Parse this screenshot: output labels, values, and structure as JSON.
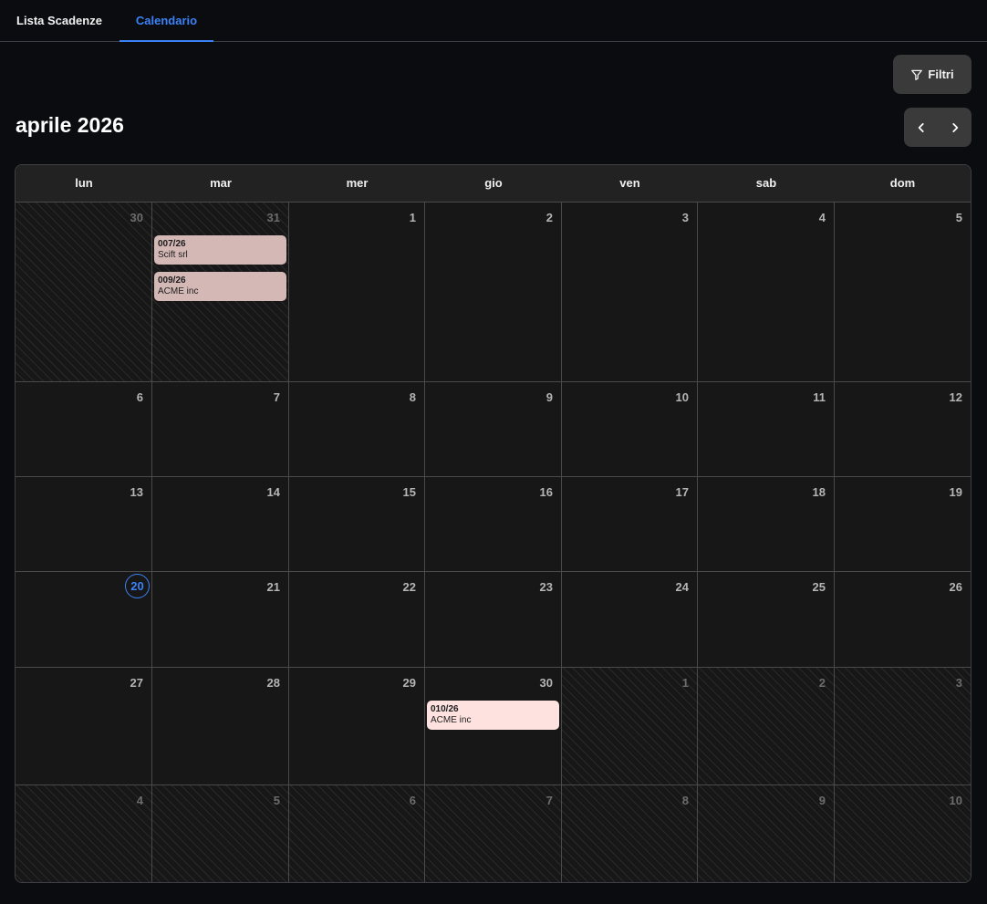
{
  "tabs": [
    {
      "label": "Lista Scadenze",
      "active": false
    },
    {
      "label": "Calendario",
      "active": true
    }
  ],
  "toolbar": {
    "filter_label": "Filtri",
    "filter_icon": "filter-icon"
  },
  "calendar": {
    "month_title": "aprile 2026",
    "nav": {
      "prev_icon": "chevron-left-icon",
      "next_icon": "chevron-right-icon"
    },
    "weekdays": [
      "lun",
      "mar",
      "mer",
      "gio",
      "ven",
      "sab",
      "dom"
    ],
    "today": "20",
    "weeks": [
      [
        {
          "day": "30",
          "other": true
        },
        {
          "day": "31",
          "other": true,
          "events": [
            {
              "code": "007/26",
              "client": "Scift srl",
              "color": "#d4b8b6"
            },
            {
              "code": "009/26",
              "client": "ACME inc",
              "color": "#d4b8b6"
            }
          ]
        },
        {
          "day": "1"
        },
        {
          "day": "2"
        },
        {
          "day": "3"
        },
        {
          "day": "4"
        },
        {
          "day": "5"
        }
      ],
      [
        {
          "day": "6"
        },
        {
          "day": "7"
        },
        {
          "day": "8"
        },
        {
          "day": "9"
        },
        {
          "day": "10"
        },
        {
          "day": "11"
        },
        {
          "day": "12"
        }
      ],
      [
        {
          "day": "13"
        },
        {
          "day": "14"
        },
        {
          "day": "15"
        },
        {
          "day": "16"
        },
        {
          "day": "17"
        },
        {
          "day": "18"
        },
        {
          "day": "19"
        }
      ],
      [
        {
          "day": "20",
          "today": true
        },
        {
          "day": "21"
        },
        {
          "day": "22"
        },
        {
          "day": "23"
        },
        {
          "day": "24"
        },
        {
          "day": "25"
        },
        {
          "day": "26"
        }
      ],
      [
        {
          "day": "27"
        },
        {
          "day": "28"
        },
        {
          "day": "29"
        },
        {
          "day": "30",
          "events": [
            {
              "code": "010/26",
              "client": "ACME inc",
              "color": "#fde2df"
            }
          ]
        },
        {
          "day": "1",
          "other": true
        },
        {
          "day": "2",
          "other": true
        },
        {
          "day": "3",
          "other": true
        }
      ],
      [
        {
          "day": "4",
          "other": true
        },
        {
          "day": "5",
          "other": true
        },
        {
          "day": "6",
          "other": true
        },
        {
          "day": "7",
          "other": true
        },
        {
          "day": "8",
          "other": true
        },
        {
          "day": "9",
          "other": true
        },
        {
          "day": "10",
          "other": true
        }
      ]
    ]
  },
  "colors": {
    "accent": "#3b82f6",
    "background": "#0a0c10",
    "cell": "#171717"
  }
}
